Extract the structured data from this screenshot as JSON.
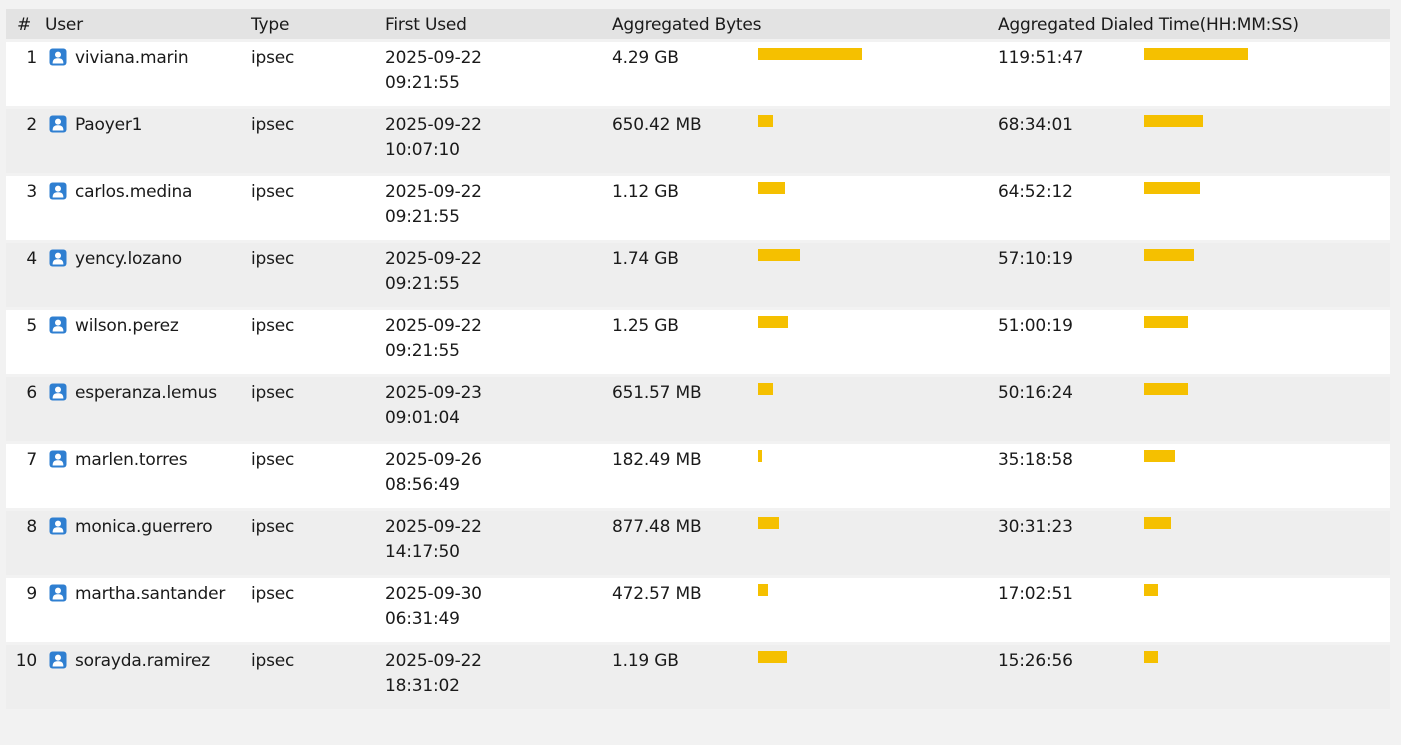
{
  "columns": {
    "index": "#",
    "user": "User",
    "type": "Type",
    "first_used": "First Used",
    "bytes": "Aggregated Bytes",
    "time": "Aggregated Dialed Time(HH:MM:SS)"
  },
  "colors": {
    "bar": "#f5c000",
    "icon": "#2f7fd1"
  },
  "rows": [
    {
      "index": "1",
      "user": "viviana.marin",
      "type": "ipsec",
      "date": "2025-09-22",
      "time_of_day": "09:21:55",
      "bytes": "4.29 GB",
      "bytes_frac": 1.0,
      "dialed": "119:51:47",
      "dialed_frac": 1.0
    },
    {
      "index": "2",
      "user": "Paoyer1",
      "type": "ipsec",
      "date": "2025-09-22",
      "time_of_day": "10:07:10",
      "bytes": "650.42 MB",
      "bytes_frac": 0.148,
      "dialed": "68:34:01",
      "dialed_frac": 0.572
    },
    {
      "index": "3",
      "user": "carlos.medina",
      "type": "ipsec",
      "date": "2025-09-22",
      "time_of_day": "09:21:55",
      "bytes": "1.12 GB",
      "bytes_frac": 0.261,
      "dialed": "64:52:12",
      "dialed_frac": 0.541
    },
    {
      "index": "4",
      "user": "yency.lozano",
      "type": "ipsec",
      "date": "2025-09-22",
      "time_of_day": "09:21:55",
      "bytes": "1.74 GB",
      "bytes_frac": 0.406,
      "dialed": "57:10:19",
      "dialed_frac": 0.477
    },
    {
      "index": "5",
      "user": "wilson.perez",
      "type": "ipsec",
      "date": "2025-09-22",
      "time_of_day": "09:21:55",
      "bytes": "1.25 GB",
      "bytes_frac": 0.291,
      "dialed": "51:00:19",
      "dialed_frac": 0.425
    },
    {
      "index": "6",
      "user": "esperanza.lemus",
      "type": "ipsec",
      "date": "2025-09-23",
      "time_of_day": "09:01:04",
      "bytes": "651.57 MB",
      "bytes_frac": 0.148,
      "dialed": "50:16:24",
      "dialed_frac": 0.419
    },
    {
      "index": "7",
      "user": "marlen.torres",
      "type": "ipsec",
      "date": "2025-09-26",
      "time_of_day": "08:56:49",
      "bytes": "182.49 MB",
      "bytes_frac": 0.0415,
      "dialed": "35:18:58",
      "dialed_frac": 0.295
    },
    {
      "index": "8",
      "user": "monica.guerrero",
      "type": "ipsec",
      "date": "2025-09-22",
      "time_of_day": "14:17:50",
      "bytes": "877.48 MB",
      "bytes_frac": 0.2,
      "dialed": "30:31:23",
      "dialed_frac": 0.255
    },
    {
      "index": "9",
      "user": "martha.santander",
      "type": "ipsec",
      "date": "2025-09-30",
      "time_of_day": "06:31:49",
      "bytes": "472.57 MB",
      "bytes_frac": 0.108,
      "dialed": "17:02:51",
      "dialed_frac": 0.142
    },
    {
      "index": "10",
      "user": "sorayda.ramirez",
      "type": "ipsec",
      "date": "2025-09-22",
      "time_of_day": "18:31:02",
      "bytes": "1.19 GB",
      "bytes_frac": 0.277,
      "dialed": "15:26:56",
      "dialed_frac": 0.129
    }
  ]
}
